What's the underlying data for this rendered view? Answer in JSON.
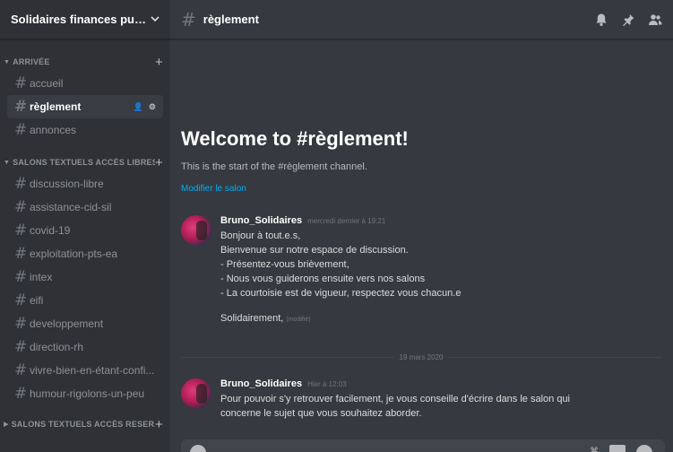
{
  "server": {
    "name": "Solidaires finances publiq...",
    "chevron_icon": "chevron-down-icon"
  },
  "categories": [
    {
      "name": "ARRIVÉE",
      "channels": [
        "accueil",
        "règlement",
        "annonces"
      ]
    },
    {
      "name": "SALONS TEXTUELS ACCÈS LIBRES",
      "channels": [
        "discussion-libre",
        "assistance-cid-sil",
        "covid-19",
        "exploitation-pts-ea",
        "intex",
        "eifi",
        "developpement",
        "direction-rh",
        "vivre-bien-en-étant-confi...",
        "humour-rigolons-un-peu"
      ]
    },
    {
      "name": "SALONS TEXTUELS ACCÈS RESER...",
      "channels": []
    }
  ],
  "active_channel": "règlement",
  "header": {
    "channel": "règlement",
    "icons": [
      "bell-icon",
      "pin-icon",
      "members-icon"
    ]
  },
  "welcome": {
    "title": "Welcome to #règlement!",
    "subtitle": "This is the start of the #règlement channel.",
    "edit_link": "Modifier le salon"
  },
  "messages": [
    {
      "author": "Bruno_Solidaires",
      "timestamp": "mercredi dernier à 19:21",
      "lines": [
        "Bonjour à tout.e.s,",
        "Bienvenue sur notre espace de discussion.",
        "- Présentez-vous brièvement,",
        "- Nous vous guiderons ensuite vers nos salons",
        "- La courtoisie est de vigueur, respectez vous chacun.e",
        "",
        "Solidairement,"
      ],
      "edited": "(modifié)"
    },
    {
      "author": "Bruno_Solidaires",
      "timestamp": "Hier à 12:03",
      "lines": [
        "Pour pouvoir s'y retrouver facilement, je vous conseille d'écrire dans le salon qui",
        "concerne le sujet que vous souhaitez aborder."
      ]
    }
  ],
  "date_divider": "19 mars 2020",
  "colors": {
    "link": "#00b0f4",
    "sidebar": "#2f3136",
    "main": "#36393f"
  }
}
